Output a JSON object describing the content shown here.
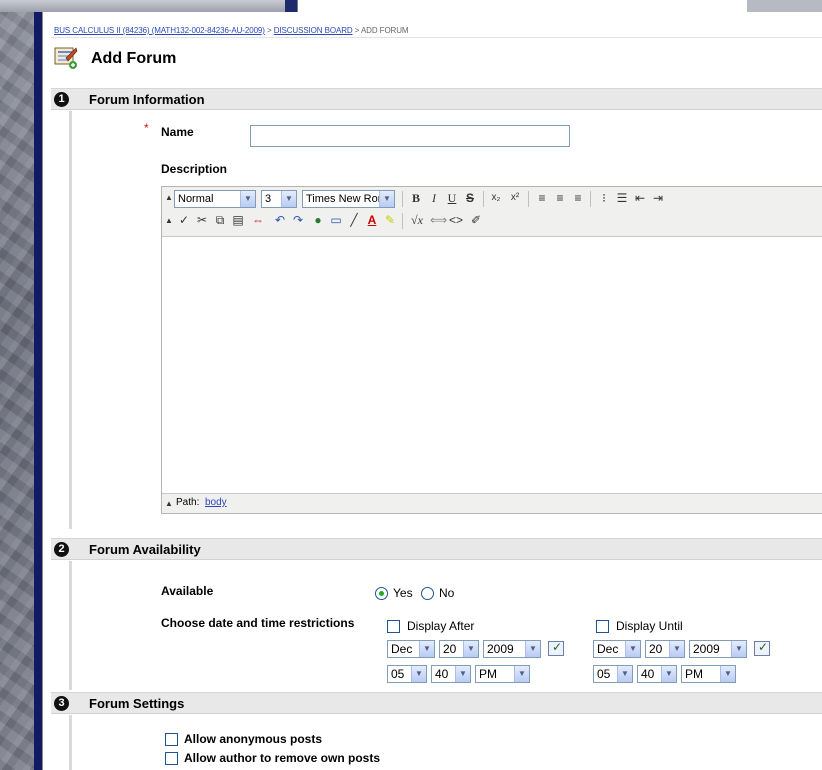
{
  "breadcrumb": {
    "course": "BUS CALCULUS II (84236) (MATH132-002-84236-AU-2009)",
    "sep1": " > ",
    "discussion_board": "DISCUSSION BOARD",
    "sep2": " > ",
    "current": "ADD FORUM"
  },
  "page_title": "Add Forum",
  "sections": {
    "info": {
      "number": "1",
      "title": "Forum Information",
      "name_label": "Name",
      "name_required_mark": "*",
      "name_value": "",
      "description_label": "Description",
      "editor": {
        "format_select": "Normal",
        "size_select": "3",
        "font_select": "Times New Roman",
        "path_label": "Path:",
        "path_value": "body"
      }
    },
    "availability": {
      "number": "2",
      "title": "Forum Availability",
      "available_label": "Available",
      "yes_label": "Yes",
      "no_label": "No",
      "available_selected": "Yes",
      "restrictions_label": "Choose date and time restrictions",
      "display_after": {
        "label": "Display After",
        "checked": false,
        "month": "Dec",
        "day": "20",
        "year": "2009",
        "hour": "05",
        "minute": "40",
        "ampm": "PM"
      },
      "display_until": {
        "label": "Display Until",
        "checked": false,
        "month": "Dec",
        "day": "20",
        "year": "2009",
        "hour": "05",
        "minute": "40",
        "ampm": "PM"
      }
    },
    "settings": {
      "number": "3",
      "title": "Forum Settings",
      "options": [
        {
          "label": "Allow anonymous posts",
          "checked": false
        },
        {
          "label": "Allow author to remove own posts",
          "checked": false
        }
      ]
    }
  },
  "colors": {
    "nav_bar": "#121a63",
    "section_header": "#e8e8e8",
    "link": "#2a48b8",
    "required": "#d11111"
  },
  "icons": {
    "page": "forum-add-icon",
    "calendar": "calendar-icon"
  }
}
